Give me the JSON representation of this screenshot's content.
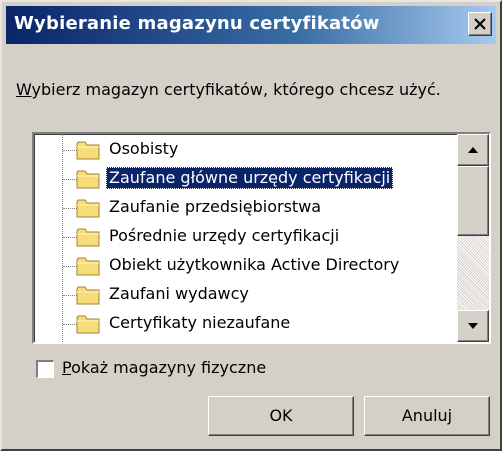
{
  "window": {
    "title": "Wybieranie magazynu certyfikatów",
    "close_glyph": "close-icon"
  },
  "instruction": {
    "accesskey": "W",
    "rest": "ybierz magazyn certyfikatów, którego chcesz użyć."
  },
  "tree": {
    "items": [
      {
        "label": "Osobisty",
        "selected": false
      },
      {
        "label": "Zaufane główne urzędy certyfikacji",
        "selected": true
      },
      {
        "label": "Zaufanie przedsiębiorstwa",
        "selected": false
      },
      {
        "label": "Pośrednie urzędy certyfikacji",
        "selected": false
      },
      {
        "label": "Obiekt użytkownika Active Directory",
        "selected": false
      },
      {
        "label": "Zaufani wydawcy",
        "selected": false
      },
      {
        "label": "Certyfikaty niezaufane",
        "selected": false
      }
    ],
    "folder_color": "#f5d76e"
  },
  "show_physical": {
    "accesskey": "P",
    "rest": "okaż magazyny fizyczne",
    "checked": false
  },
  "buttons": {
    "ok": "OK",
    "cancel": "Anuluj"
  },
  "colors": {
    "title_bar": "#0a246a",
    "selection": "#0a246a",
    "face": "#d4d0c8"
  }
}
